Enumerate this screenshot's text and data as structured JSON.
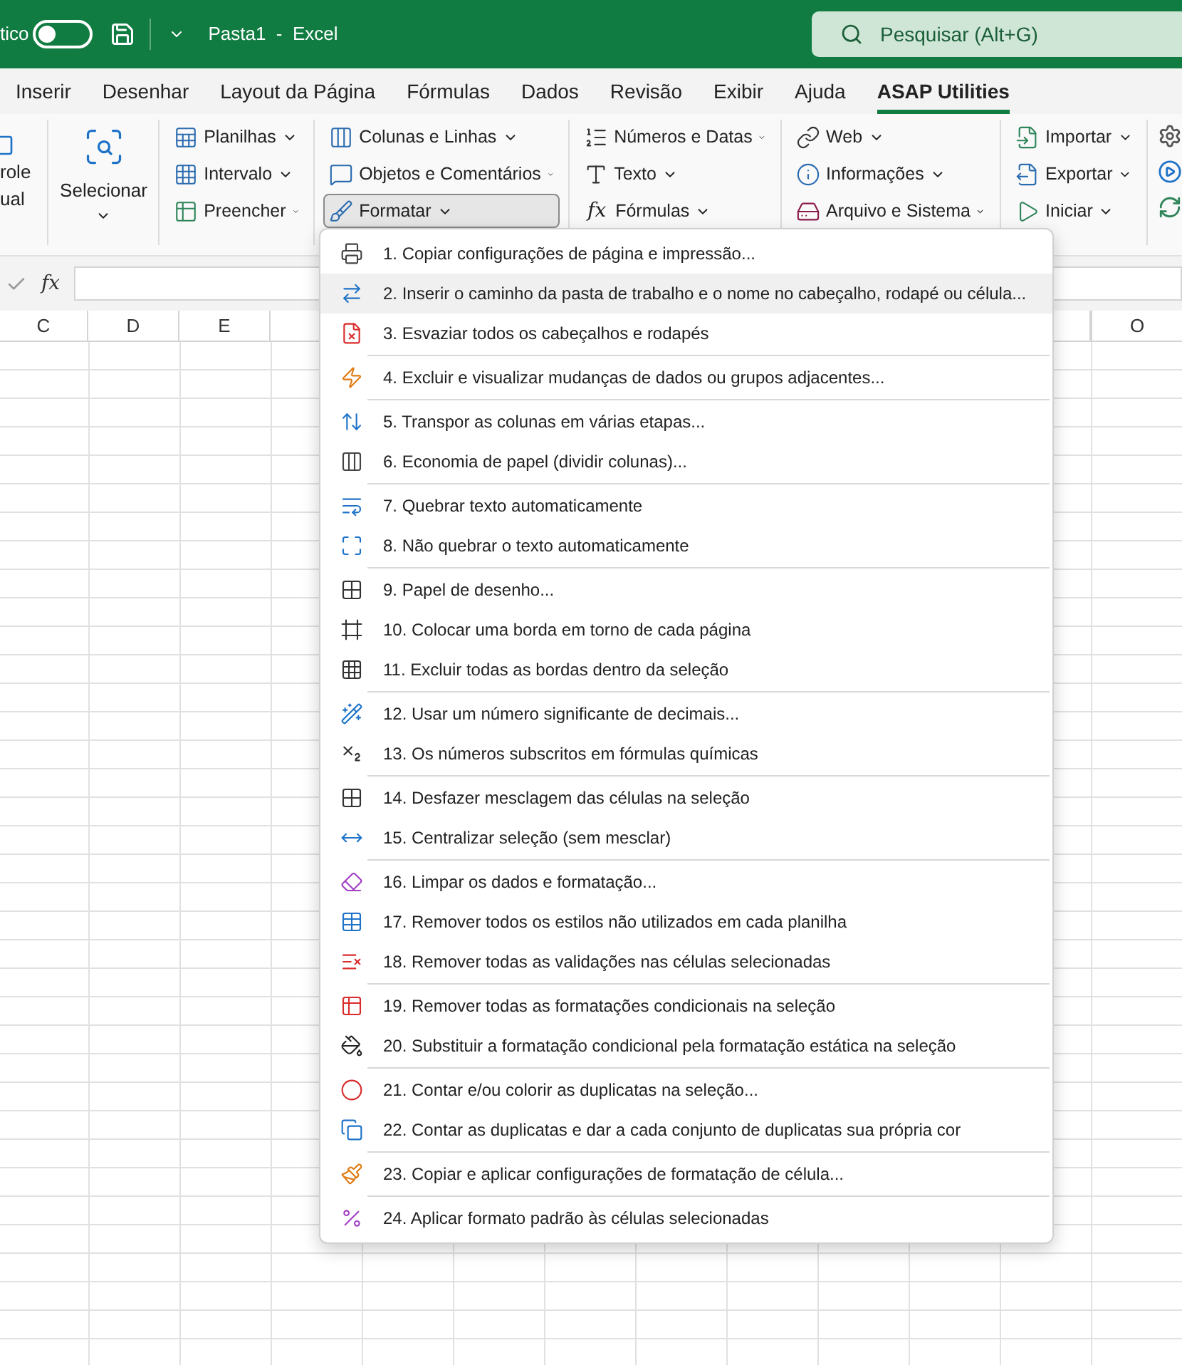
{
  "title_bar": {
    "autosave_label": "tico",
    "autosave_on": false,
    "document_title": "Pasta1  -  Excel",
    "search": {
      "placeholder": "Pesquisar (Alt+G)"
    }
  },
  "tabs": [
    {
      "label": "Inserir",
      "selected": false
    },
    {
      "label": "Desenhar",
      "selected": false
    },
    {
      "label": "Layout da Página",
      "selected": false
    },
    {
      "label": "Fórmulas",
      "selected": false
    },
    {
      "label": "Dados",
      "selected": false
    },
    {
      "label": "Revisão",
      "selected": false
    },
    {
      "label": "Exibir",
      "selected": false
    },
    {
      "label": "Ajuda",
      "selected": false
    },
    {
      "label": "ASAP Utilities",
      "selected": true
    }
  ],
  "ribbon": {
    "cut_group": {
      "lines": [
        "role",
        "ual"
      ]
    },
    "select_button": {
      "label": "Selecionar"
    },
    "groups": [
      {
        "items": [
          {
            "label": "Planilhas",
            "expanded": false
          },
          {
            "label": "Intervalo",
            "expanded": false
          },
          {
            "label": "Preencher",
            "expanded": false
          }
        ]
      },
      {
        "items": [
          {
            "label": "Colunas e Linhas",
            "expanded": false
          },
          {
            "label": "Objetos e Comentários",
            "expanded": false
          },
          {
            "label": "Formatar",
            "expanded": true
          }
        ]
      },
      {
        "items": [
          {
            "label": "Números e Datas",
            "expanded": false
          },
          {
            "label": "Texto",
            "expanded": false
          },
          {
            "label": "Fórmulas",
            "expanded": false,
            "icon_text": "fx"
          }
        ]
      },
      {
        "items": [
          {
            "label": "Web",
            "expanded": false
          },
          {
            "label": "Informações",
            "expanded": false
          },
          {
            "label": "Arquivo e Sistema",
            "expanded": false
          }
        ]
      },
      {
        "items": [
          {
            "label": "Importar",
            "expanded": false
          },
          {
            "label": "Exportar",
            "expanded": false
          },
          {
            "label": "Iniciar",
            "expanded": false
          }
        ]
      }
    ]
  },
  "formula_bar": {
    "function_label": "fx"
  },
  "columns": [
    "C",
    "D",
    "E",
    "O"
  ],
  "menu": {
    "groups": [
      {
        "items": [
          {
            "label": "1. Copiar configurações de página e impressão...",
            "highlighted": false
          },
          {
            "label": "2. Inserir o caminho da pasta de trabalho e o nome no cabeçalho, rodapé ou célula...",
            "highlighted": true
          },
          {
            "label": "3. Esvaziar todos os cabeçalhos e rodapés",
            "highlighted": false
          }
        ]
      },
      {
        "items": [
          {
            "label": "4. Excluir e visualizar mudanças de dados ou grupos adjacentes...",
            "highlighted": false
          }
        ]
      },
      {
        "items": [
          {
            "label": "5. Transpor as colunas em várias etapas...",
            "highlighted": false
          },
          {
            "label": "6. Economia de papel (dividir colunas)...",
            "highlighted": false
          }
        ]
      },
      {
        "items": [
          {
            "label": "7. Quebrar texto automaticamente",
            "highlighted": false
          },
          {
            "label": "8. Não quebrar o texto automaticamente",
            "highlighted": false
          }
        ]
      },
      {
        "items": [
          {
            "label": "9. Papel de desenho...",
            "highlighted": false
          },
          {
            "label": "10. Colocar uma borda em torno de cada página",
            "highlighted": false
          },
          {
            "label": "11. Excluir todas as bordas dentro da seleção",
            "highlighted": false
          }
        ]
      },
      {
        "items": [
          {
            "label": "12. Usar um número significante de decimais...",
            "highlighted": false
          },
          {
            "label": "13. Os números subscritos em fórmulas químicas",
            "highlighted": false
          }
        ]
      },
      {
        "items": [
          {
            "label": "14. Desfazer mesclagem das células na seleção",
            "highlighted": false
          },
          {
            "label": "15. Centralizar seleção (sem mesclar)",
            "highlighted": false
          }
        ]
      },
      {
        "items": [
          {
            "label": "16. Limpar os dados e formatação...",
            "highlighted": false
          },
          {
            "label": "17. Remover todos os estilos não utilizados em cada planilha",
            "highlighted": false
          },
          {
            "label": "18. Remover todas as validações nas células selecionadas",
            "highlighted": false
          }
        ]
      },
      {
        "items": [
          {
            "label": "19. Remover todas as formatações condicionais na seleção",
            "highlighted": false
          },
          {
            "label": "20. Substituir a formatação condicional pela formatação estática na seleção",
            "highlighted": false
          }
        ]
      },
      {
        "items": [
          {
            "label": "21. Contar e/ou colorir as duplicatas na seleção...",
            "highlighted": false
          },
          {
            "label": "22. Contar as duplicatas e dar a cada conjunto de duplicatas sua própria cor",
            "highlighted": false
          }
        ]
      },
      {
        "items": [
          {
            "label": "23. Copiar e aplicar configurações de formatação de célula...",
            "highlighted": false
          }
        ]
      },
      {
        "items": [
          {
            "label": "24. Aplicar formato padrão às células selecionadas",
            "highlighted": false
          }
        ]
      }
    ]
  }
}
